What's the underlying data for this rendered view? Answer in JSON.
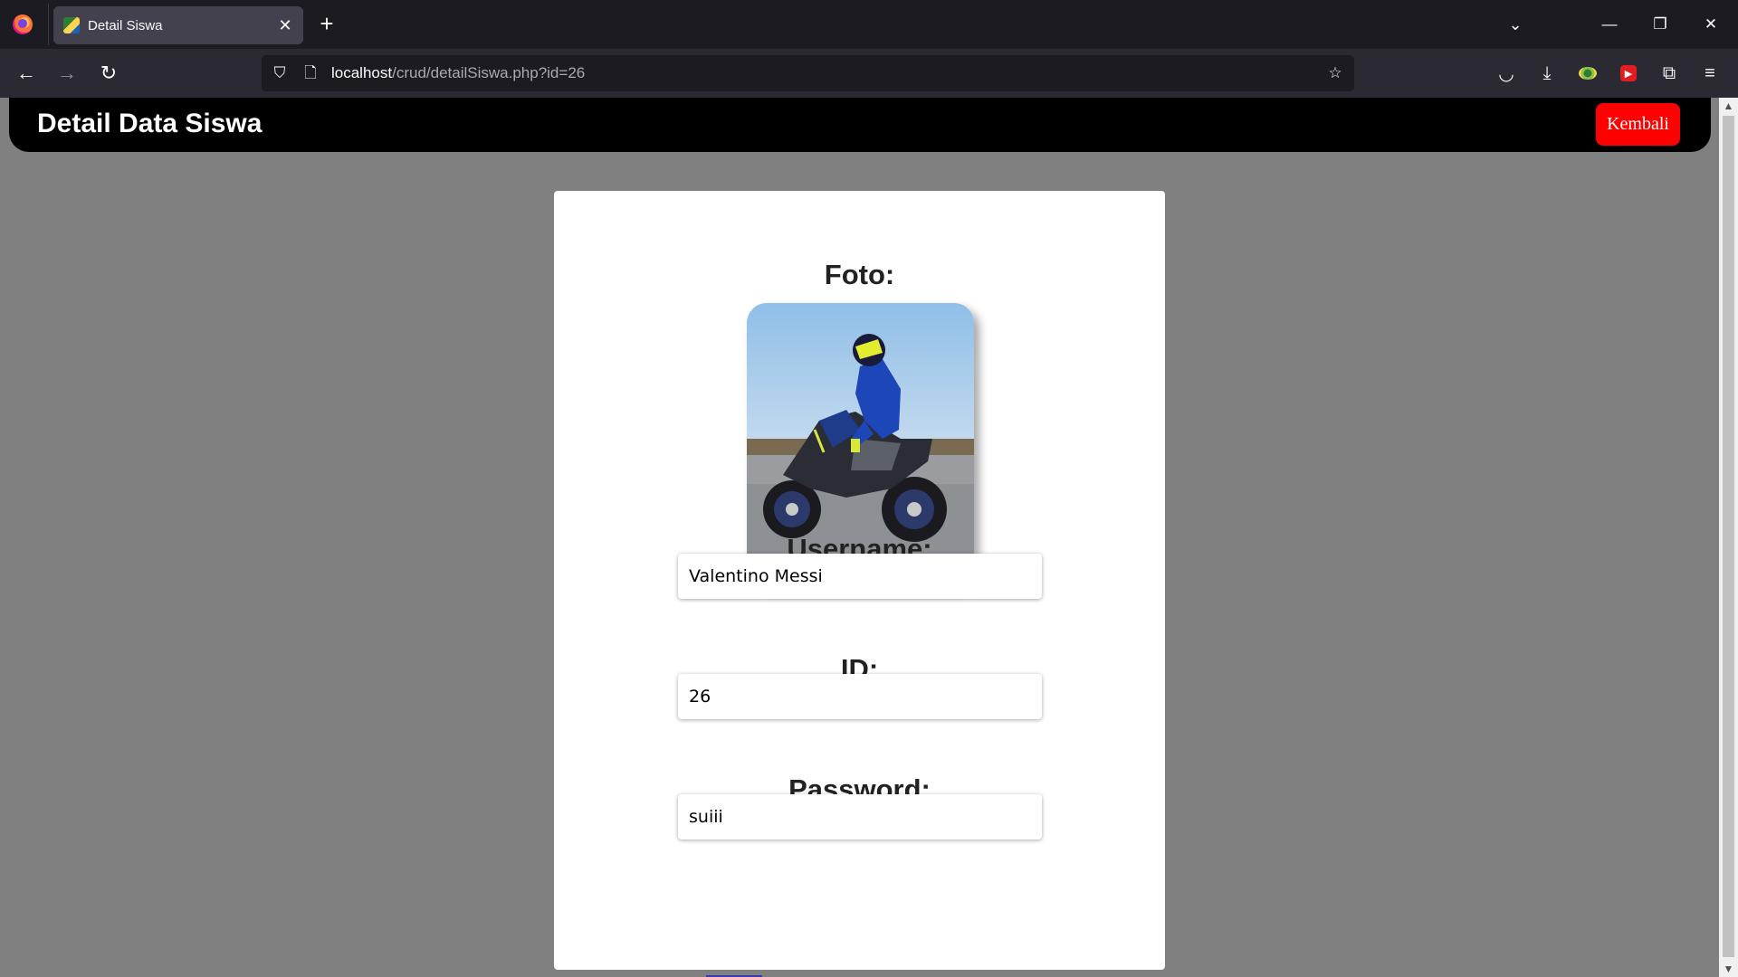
{
  "browser": {
    "tab_title": "Detail Siswa",
    "url_host": "localhost",
    "url_path": "/crud/detailSiswa.php?id=26",
    "icons": [
      "firefox-logo",
      "close-icon",
      "plus-icon",
      "chevron-down-icon",
      "minimize-icon",
      "restore-icon",
      "back-arrow-icon",
      "forward-arrow-icon",
      "reload-icon",
      "shield-icon",
      "page-icon",
      "star-icon",
      "pocket-icon",
      "download-icon",
      "extension-icon",
      "menu-icon"
    ]
  },
  "header": {
    "title": "Detail Data Siswa",
    "back_label": "Kembali",
    "back_color": "#ff0000"
  },
  "detail": {
    "photo_label": "Foto:",
    "username_label": "Username:",
    "username_value": "Valentino Messi",
    "id_label": "ID:",
    "id_value": "26",
    "password_label": "Password:",
    "password_value": "suiii"
  }
}
